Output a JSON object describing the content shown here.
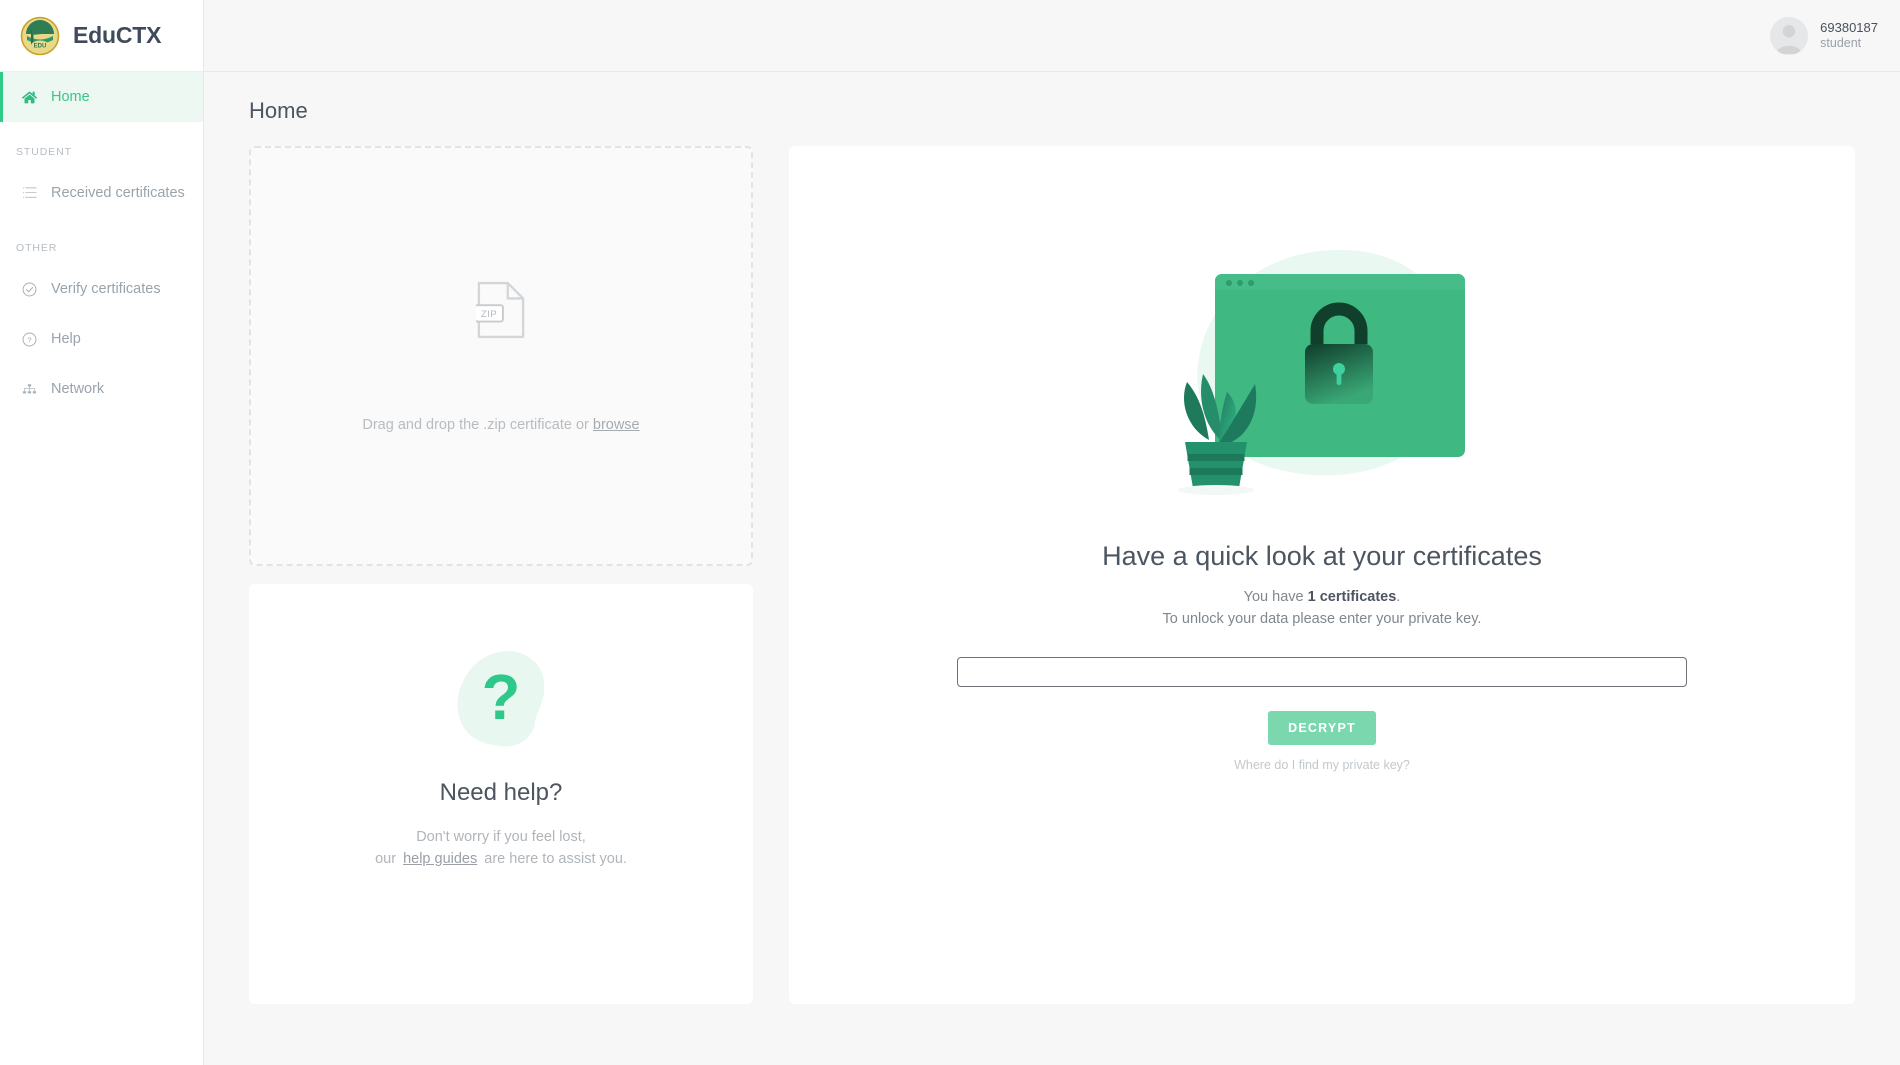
{
  "brand": {
    "name": "EduCTX",
    "logo_icon": "eductx-graduation-cap-logo",
    "logo_text": "EDU"
  },
  "user": {
    "name": "69380187",
    "role": "student",
    "avatar_icon": "user-avatar-placeholder-icon"
  },
  "sidebar": {
    "items": [
      {
        "label": "Home",
        "icon": "home-icon",
        "active": true
      }
    ],
    "sections": [
      {
        "title": "STUDENT",
        "items": [
          {
            "label": "Received certificates",
            "icon": "list-icon"
          }
        ]
      },
      {
        "title": "OTHER",
        "items": [
          {
            "label": "Verify certificates",
            "icon": "check-circle-icon"
          },
          {
            "label": "Help",
            "icon": "question-circle-icon"
          },
          {
            "label": "Network",
            "icon": "network-sitemap-icon"
          }
        ]
      }
    ]
  },
  "page": {
    "title": "Home"
  },
  "dropzone": {
    "icon": "zip-file-icon",
    "icon_label": "ZIP",
    "text_prefix": "Drag and drop the .zip certificate or ",
    "browse_label": "browse"
  },
  "help_card": {
    "icon": "question-mark-blob-icon",
    "title": "Need help?",
    "line1": "Don't worry if you feel lost,",
    "line2_prefix": "our",
    "link_label": "help guides",
    "line2_suffix": "are here to assist you."
  },
  "certificates": {
    "illustration_icon": "locked-browser-window-with-plant-illustration",
    "title": "Have a quick look at your certificates",
    "count_prefix": "You have ",
    "count_strong": "1 certificates",
    "count_suffix": ".",
    "instruction": "To unlock your data please enter your private key.",
    "input_value": "",
    "input_placeholder": "",
    "decrypt_label": "DECRYPT",
    "find_key_label": "Where do I find my private key?"
  },
  "colors": {
    "accent_green": "#2ecc87",
    "button_green": "#7ad7ae",
    "illustration_green": "#3fb882",
    "page_bg": "#f7f7f8",
    "text_dark": "#4c5560",
    "text_muted": "#b0b5ba"
  }
}
